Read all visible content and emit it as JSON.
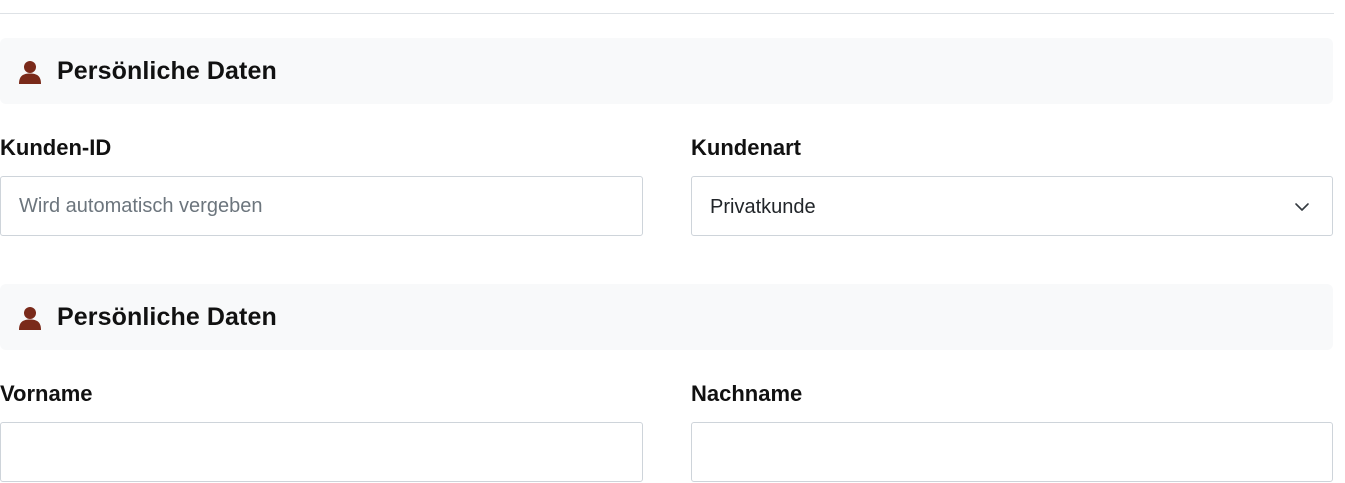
{
  "sections": [
    {
      "title": "Persönliche Daten",
      "icon": "person-icon",
      "fields": {
        "left": {
          "label": "Kunden-ID",
          "value": "",
          "placeholder": "Wird automatisch vergeben"
        },
        "right": {
          "label": "Kundenart",
          "selected": "Privatkunde",
          "icon": "chevron-down-icon"
        }
      }
    },
    {
      "title": "Persönliche Daten",
      "icon": "person-icon",
      "fields": {
        "left": {
          "label": "Vorname",
          "value": "",
          "placeholder": ""
        },
        "right": {
          "label": "Nachname",
          "value": "",
          "placeholder": ""
        }
      }
    }
  ],
  "colors": {
    "icon": "#7a2a1a",
    "section_background": "#f8f9fa",
    "input_border": "#ced4da",
    "placeholder": "#6c757d"
  }
}
